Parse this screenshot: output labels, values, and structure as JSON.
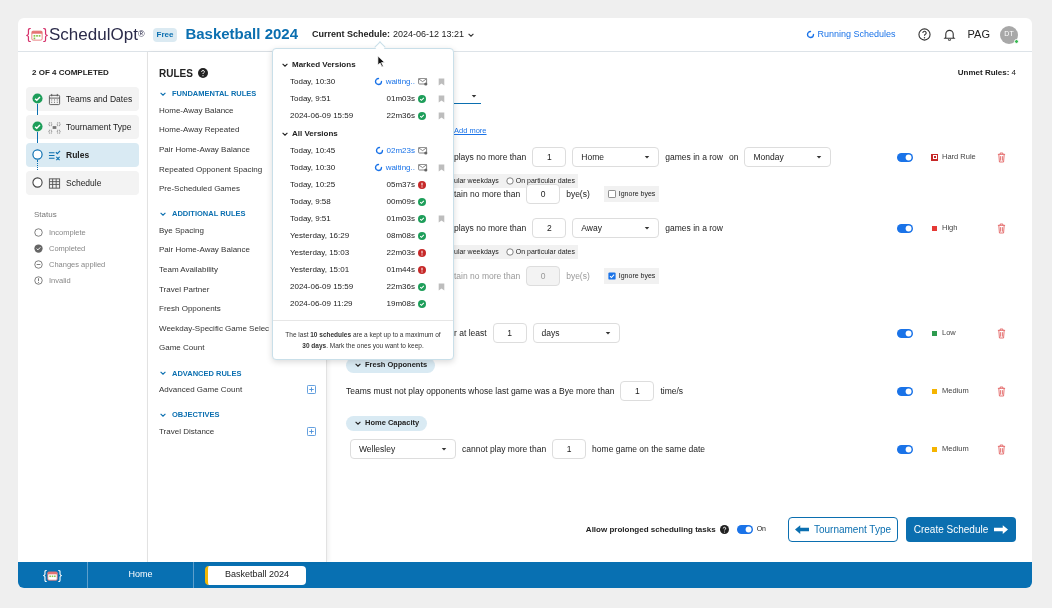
{
  "header": {
    "logo_left": "{",
    "logo_right": "}",
    "brand": "SchedulOpt",
    "brand_mark": "®",
    "plan": "Free",
    "title": "Basketball 2024",
    "current_label": "Current Schedule:",
    "current_value": "2024-06-12 13:21",
    "running": "Running Schedules",
    "user": "PAG",
    "avatar": "DT"
  },
  "wizard": {
    "progress": "2 OF 4 COMPLETED",
    "steps": [
      {
        "label": "Teams and Dates",
        "kind": "calendar",
        "completed": true,
        "selected": false
      },
      {
        "label": "Tournament Type",
        "kind": "bracket",
        "completed": true,
        "selected": false
      },
      {
        "label": "Rules",
        "kind": "rules",
        "completed": false,
        "selected": true
      },
      {
        "label": "Schedule",
        "kind": "table",
        "completed": false,
        "selected": false
      }
    ],
    "status_title": "Status",
    "legend": [
      {
        "label": "Incomplete",
        "kind": "incomplete"
      },
      {
        "label": "Completed",
        "kind": "completed"
      },
      {
        "label": "Changes applied",
        "kind": "changes"
      },
      {
        "label": "Invalid",
        "kind": "invalid"
      }
    ]
  },
  "rules_panel": {
    "title": "RULES",
    "sections": [
      {
        "title": "FUNDAMENTAL RULES",
        "expanded": true,
        "items": [
          {
            "label": "Home-Away Balance"
          },
          {
            "label": "Home-Away Repeated"
          },
          {
            "label": "Pair Home-Away Balance"
          },
          {
            "label": "Repeated Opponent Spacing"
          },
          {
            "label": "Pre-Scheduled Games"
          }
        ]
      },
      {
        "title": "ADDITIONAL RULES",
        "expanded": true,
        "items": [
          {
            "label": "Bye Spacing"
          },
          {
            "label": "Pair Home-Away Balance"
          },
          {
            "label": "Team Availability"
          },
          {
            "label": "Travel Partner"
          },
          {
            "label": "Fresh Opponents"
          },
          {
            "label": "Weekday-Specific Game Selec"
          },
          {
            "label": "Game Count"
          }
        ]
      },
      {
        "title": "ADVANCED RULES",
        "expanded": true,
        "items": [
          {
            "label": "Advanced Game Count",
            "addable": true
          }
        ]
      },
      {
        "title": "OBJECTIVES",
        "expanded": true,
        "items": [
          {
            "label": "Travel Distance",
            "addable": true
          }
        ]
      }
    ]
  },
  "versions_popup": {
    "sections": [
      {
        "title": "Marked Versions",
        "expanded": true,
        "rows": [
          {
            "time": "Today, 10:30",
            "kind": "running",
            "duration": "waiting..",
            "marked": true
          },
          {
            "time": "Today, 9:51",
            "kind": "success",
            "duration": "01m03s",
            "marked": true
          },
          {
            "time": "2024-06-09 15:59",
            "kind": "success",
            "duration": "22m36s",
            "marked": true
          }
        ]
      },
      {
        "title": "All Versions",
        "expanded": true,
        "rows": [
          {
            "time": "Today, 10:45",
            "kind": "running",
            "duration": "02m23s",
            "marked": false
          },
          {
            "time": "Today, 10:30",
            "kind": "running",
            "duration": "waiting..",
            "marked": true
          },
          {
            "time": "Today, 10:25",
            "kind": "error",
            "duration": "05m37s",
            "marked": false
          },
          {
            "time": "Today, 9:58",
            "kind": "success",
            "duration": "00m09s",
            "marked": false
          },
          {
            "time": "Today, 9:51",
            "kind": "success",
            "duration": "01m03s",
            "marked": true
          },
          {
            "time": "Yesterday, 16:29",
            "kind": "success",
            "duration": "08m08s",
            "marked": false
          },
          {
            "time": "Yesterday, 15:03",
            "kind": "error",
            "duration": "22m03s",
            "marked": false
          },
          {
            "time": "Yesterday, 15:01",
            "kind": "error",
            "duration": "01m44s",
            "marked": false
          },
          {
            "time": "2024-06-09 15:59",
            "kind": "success",
            "duration": "22m36s",
            "marked": true
          },
          {
            "time": "2024-06-09 11:29",
            "kind": "success",
            "duration": "19m08s",
            "marked": false
          }
        ]
      }
    ],
    "note": "The last **10 schedules** are a kept up to a maximum of **30 days**. Mark the ones you want to keep."
  },
  "main": {
    "unmet_label": "Unmet Rules:",
    "unmet_count": "4",
    "lines": [
      {
        "parts": [
          {
            "kind": "underline_select"
          }
        ]
      },
      {
        "parts": [
          {
            "kind": "link",
            "text": "Add more"
          }
        ]
      },
      {
        "parts": [
          {
            "kind": "text",
            "text": "plays no more than"
          },
          {
            "kind": "number",
            "text": "1"
          },
          {
            "kind": "select",
            "text": "Home"
          },
          {
            "kind": "text",
            "text": "games in a row"
          },
          {
            "kind": "text",
            "text": "on"
          },
          {
            "kind": "select",
            "text": "Monday"
          }
        ],
        "rule": {
          "on": true,
          "priority": "Hard Rule",
          "kind": "hard",
          "color": "#c62828"
        }
      },
      {
        "parts": [
          {
            "kind": "option",
            "text": "ular weekdays"
          },
          {
            "kind": "radio",
            "text": "On particular dates",
            "checked": false
          }
        ]
      },
      {
        "parts": [
          {
            "kind": "text",
            "text": "tain no more than"
          },
          {
            "kind": "number",
            "text": "0"
          },
          {
            "kind": "text",
            "text": "bye(s)"
          },
          {
            "kind": "checkbox",
            "text": "Ignore byes",
            "checked": false
          }
        ]
      },
      {
        "parts": [
          {
            "kind": "text",
            "text": "plays no more than"
          },
          {
            "kind": "number",
            "text": "2"
          },
          {
            "kind": "select",
            "text": "Away"
          },
          {
            "kind": "text",
            "text": "games in a row"
          }
        ],
        "rule": {
          "on": true,
          "priority": "High",
          "kind": "level",
          "color": "#e53935"
        }
      },
      {
        "parts": [
          {
            "kind": "option",
            "text": "ular weekdays"
          },
          {
            "kind": "radio",
            "text": "On particular dates",
            "checked": false
          }
        ]
      },
      {
        "disabled": true,
        "parts": [
          {
            "kind": "text",
            "text": "tain no more than"
          },
          {
            "kind": "number",
            "text": "0"
          },
          {
            "kind": "text",
            "text": "bye(s)"
          },
          {
            "kind": "checkbox",
            "text": "Ignore byes",
            "checked": true
          }
        ]
      },
      {
        "parts": [
          {
            "kind": "text",
            "text": "r at least"
          },
          {
            "kind": "number",
            "text": "1"
          },
          {
            "kind": "select",
            "text": "days"
          }
        ],
        "rule": {
          "on": true,
          "priority": "Low",
          "kind": "level",
          "color": "#2e9b4f"
        }
      },
      {
        "parts": [
          {
            "kind": "heading",
            "text": "Fresh Opponents"
          }
        ]
      },
      {
        "parts": [
          {
            "kind": "text",
            "text": "Teams must not play opponents whose last game was a Bye more than"
          },
          {
            "kind": "number",
            "text": "1"
          },
          {
            "kind": "text",
            "text": "time/s"
          }
        ],
        "rule": {
          "on": true,
          "priority": "Medium",
          "kind": "level",
          "color": "#f5b400"
        }
      },
      {
        "parts": [
          {
            "kind": "heading",
            "text": "Home Capacity"
          }
        ]
      },
      {
        "parts": [
          {
            "kind": "select",
            "text": "Wellesley",
            "wide": true
          },
          {
            "kind": "text",
            "text": "cannot play more than"
          },
          {
            "kind": "number",
            "text": "1"
          },
          {
            "kind": "text",
            "text": "home game on the same date"
          }
        ],
        "rule": {
          "on": true,
          "priority": "Medium",
          "kind": "level",
          "color": "#f5b400"
        }
      }
    ],
    "footer": {
      "prolonged_label": "Allow prolonged scheduling tasks",
      "prolonged_on": true,
      "prolonged_state": "On",
      "back": "Tournament Type",
      "next": "Create Schedule"
    }
  },
  "taskbar": {
    "home": "Home",
    "tabs": [
      {
        "label": "Basketball 2024",
        "selected": true
      }
    ]
  }
}
